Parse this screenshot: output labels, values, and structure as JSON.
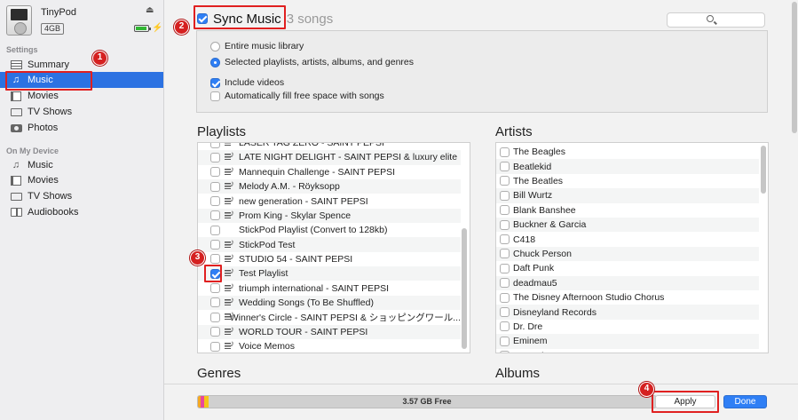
{
  "device": {
    "name": "TinyPod",
    "capacity": "4GB",
    "icons": {
      "eject": "eject-icon",
      "battery": "battery-icon",
      "charging": "charging-icon"
    }
  },
  "sidebar": {
    "settings_label": "Settings",
    "settings_items": [
      {
        "label": "Summary",
        "icon": "summary-list-icon"
      },
      {
        "label": "Music",
        "icon": "music-note-icon",
        "selected": true
      },
      {
        "label": "Movies",
        "icon": "film-icon"
      },
      {
        "label": "TV Shows",
        "icon": "tv-icon"
      },
      {
        "label": "Photos",
        "icon": "camera-icon"
      }
    ],
    "on_device_label": "On My Device",
    "device_items": [
      {
        "label": "Music",
        "icon": "music-note-icon"
      },
      {
        "label": "Movies",
        "icon": "film-icon"
      },
      {
        "label": "TV Shows",
        "icon": "tv-icon"
      },
      {
        "label": "Audiobooks",
        "icon": "book-icon"
      }
    ]
  },
  "sync": {
    "title": "Sync Music",
    "count": "3 songs",
    "checked": true
  },
  "options": {
    "radio_entire": "Entire music library",
    "radio_selected": "Selected playlists, artists, albums, and genres",
    "include_videos": "Include videos",
    "autofill": "Automatically fill free space with songs"
  },
  "playlists": {
    "title": "Playlists",
    "items": [
      {
        "label": "LASER TAG ZERO - SAINT PEPSI",
        "checked": false
      },
      {
        "label": "LATE NIGHT DELIGHT - SAINT PEPSI & luxury elite",
        "checked": false
      },
      {
        "label": "Mannequin Challenge - SAINT PEPSI",
        "checked": false
      },
      {
        "label": "Melody A.M. - Röyksopp",
        "checked": false
      },
      {
        "label": "new generation - SAINT PEPSI",
        "checked": false
      },
      {
        "label": "Prom King - Skylar Spence",
        "checked": false
      },
      {
        "label": "StickPod Playlist (Convert to 128kb)",
        "checked": false,
        "no_icon": true
      },
      {
        "label": "StickPod Test",
        "checked": false
      },
      {
        "label": "STUDIO 54 - SAINT PEPSI",
        "checked": false
      },
      {
        "label": "Test Playlist",
        "checked": true
      },
      {
        "label": "triumph international - SAINT PEPSI",
        "checked": false
      },
      {
        "label": "Wedding Songs (To Be Shuffled)",
        "checked": false
      },
      {
        "label": "Winner's Circle - SAINT PEPSI & ショッピングワール...",
        "checked": false
      },
      {
        "label": "WORLD TOUR - SAINT PEPSI",
        "checked": false
      },
      {
        "label": "Voice Memos",
        "checked": false
      }
    ]
  },
  "artists": {
    "title": "Artists",
    "items": [
      "The Beagles",
      "Beatlekid",
      "The Beatles",
      "Bill Wurtz",
      "Blank Banshee",
      "Buckner & Garcia",
      "C418",
      "Chuck Person",
      "Daft Punk",
      "deadmau5",
      "The Disney Afternoon Studio Chorus",
      "Disneyland Records",
      "Dr. Dre",
      "Eminem",
      "Fantasia"
    ]
  },
  "genres_title": "Genres",
  "albums_title": "Albums",
  "storage": {
    "free_label": "3.57 GB Free",
    "segments": [
      {
        "color": "#f5a623",
        "fraction": 0.006
      },
      {
        "color": "#e8479e",
        "fraction": 0.008
      },
      {
        "color": "#f5c518",
        "fraction": 0.01
      }
    ]
  },
  "buttons": {
    "apply": "Apply",
    "done": "Done"
  },
  "annotations": [
    "1",
    "2",
    "3",
    "4"
  ],
  "accent_color": "#2f7ff5",
  "highlight_color": "#e02020"
}
